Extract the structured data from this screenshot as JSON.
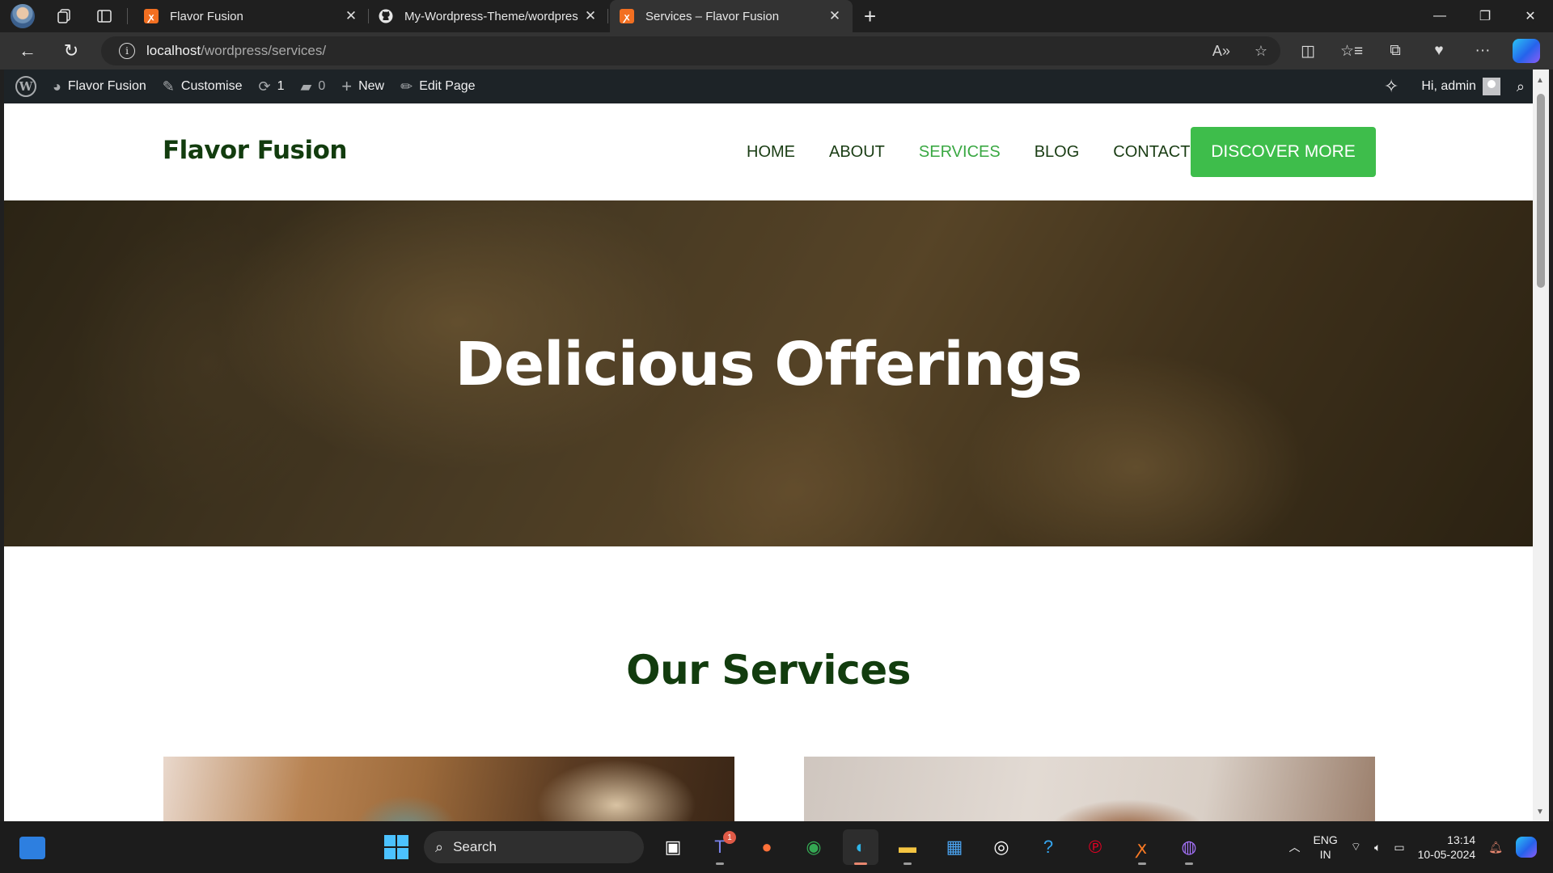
{
  "browser": {
    "tabs": [
      {
        "title": "Flavor Fusion",
        "icon": "xampp-icon",
        "active": false
      },
      {
        "title": "My-Wordpress-Theme/wordpres",
        "icon": "github-icon",
        "active": false
      },
      {
        "title": "Services – Flavor Fusion",
        "icon": "xampp-icon",
        "active": true
      }
    ],
    "url_host": "localhost",
    "url_path": "/wordpress/services/"
  },
  "admin_bar": {
    "site_name": "Flavor Fusion",
    "customise": "Customise",
    "updates_count": "1",
    "comments_count": "0",
    "new_label": "New",
    "edit_label": "Edit Page",
    "greeting": "Hi, admin"
  },
  "site": {
    "brand": "Flavor Fusion",
    "nav": [
      {
        "label": "HOME",
        "active": false
      },
      {
        "label": "ABOUT",
        "active": false
      },
      {
        "label": "SERVICES",
        "active": true
      },
      {
        "label": "BLOG",
        "active": false
      },
      {
        "label": "CONTACT",
        "active": false
      }
    ],
    "cta": "DISCOVER MORE",
    "hero_title": "Delicious Offerings",
    "section_title": "Our Services"
  },
  "colors": {
    "brand_green": "#123c0e",
    "accent_green": "#3ebd4b",
    "active_nav": "#3aa843",
    "admin_bar": "#1d2327"
  },
  "taskbar": {
    "search_label": "Search",
    "lang_line1": "ENG",
    "lang_line2": "IN",
    "time": "13:14",
    "date": "10-05-2024",
    "teams_badge": "1"
  }
}
